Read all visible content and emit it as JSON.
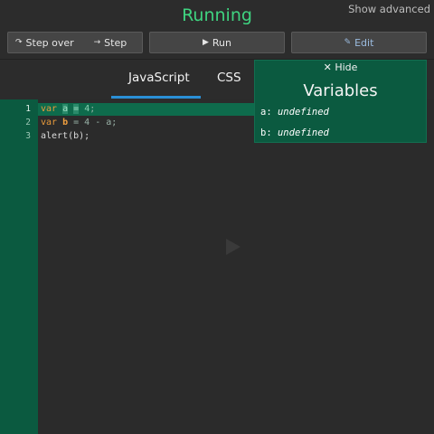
{
  "header": {
    "status": "Running",
    "show_advanced": "Show advanced"
  },
  "toolbar": {
    "step_over_icon": "↷",
    "step_over_label": "Step over",
    "step_icon": "→",
    "step_label": "Step",
    "run_icon": "▶",
    "run_label": "Run",
    "edit_icon": "✎",
    "edit_label": "Edit"
  },
  "tabs": [
    {
      "label": "JavaScript",
      "active": true
    },
    {
      "label": "CSS",
      "active": false
    }
  ],
  "editor": {
    "line_numbers": [
      "1",
      "2",
      "3"
    ],
    "active_line": 1,
    "lines": [
      {
        "kw": "var",
        "id": "a",
        "op": "=",
        "val": "4",
        "end": ";"
      },
      {
        "kw": "var",
        "id": "b",
        "rest": " = 4 - a;"
      },
      {
        "text": "alert(b);"
      }
    ]
  },
  "variables_panel": {
    "hide_icon": "✕",
    "hide_label": "Hide",
    "title": "Variables",
    "vars": [
      {
        "name": "a:",
        "value": "undefined"
      },
      {
        "name": "b:",
        "value": "undefined"
      }
    ]
  },
  "colors": {
    "status_green": "#3fd480",
    "panel_green": "#0b5a40",
    "tab_underline": "#2a8fd6",
    "keyword": "#e89b3c"
  }
}
